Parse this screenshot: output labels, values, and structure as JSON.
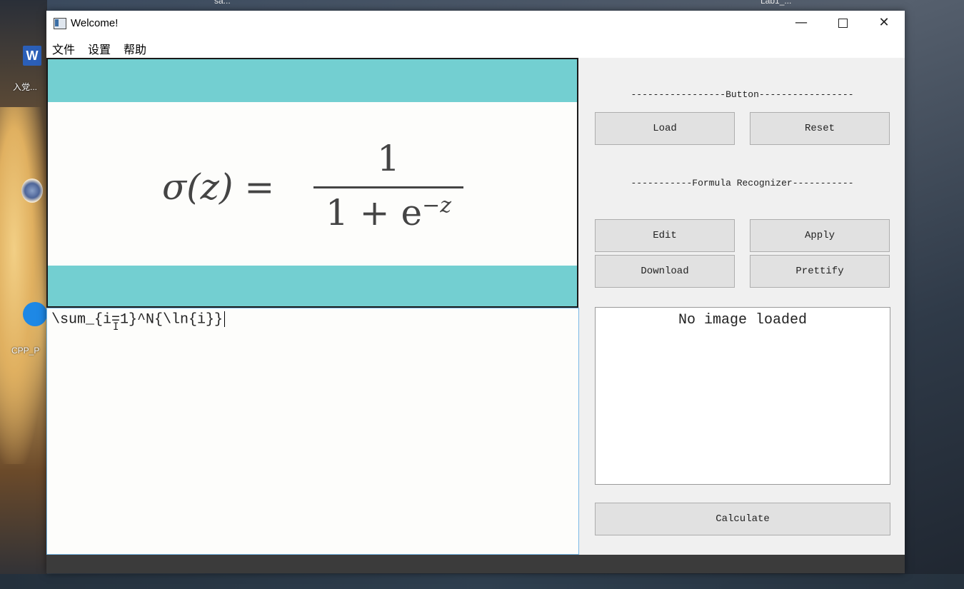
{
  "desktop": {
    "word_label": "入党...",
    "word_icon_letter": "W",
    "app_label": "CPP_P",
    "top_left_text": "sa...",
    "top_right_text": "Lab1_..."
  },
  "window": {
    "title": "Welcome!",
    "controls": {
      "minimize": "—",
      "close": "✕"
    }
  },
  "menu": [
    "文件",
    "设置",
    "帮助"
  ],
  "preview": {
    "formula_lhs": "σ(z) =",
    "numerator": "1",
    "denominator_base": "1 + e",
    "denominator_exp": "−z"
  },
  "editor": {
    "value": "\\sum_{i=1}^N{\\ln{i}}"
  },
  "panel": {
    "button_section": "-----------------Button-----------------",
    "load": "Load",
    "reset": "Reset",
    "recognizer_section": "-----------Formula Recognizer-----------",
    "edit": "Edit",
    "apply": "Apply",
    "download": "Download",
    "prettify": "Prettify",
    "status": "No image loaded",
    "calculate": "Calculate"
  },
  "colors": {
    "preview_band": "#73cfd1",
    "window_bg": "#f0f0f0",
    "button_bg": "#e1e1e1"
  }
}
